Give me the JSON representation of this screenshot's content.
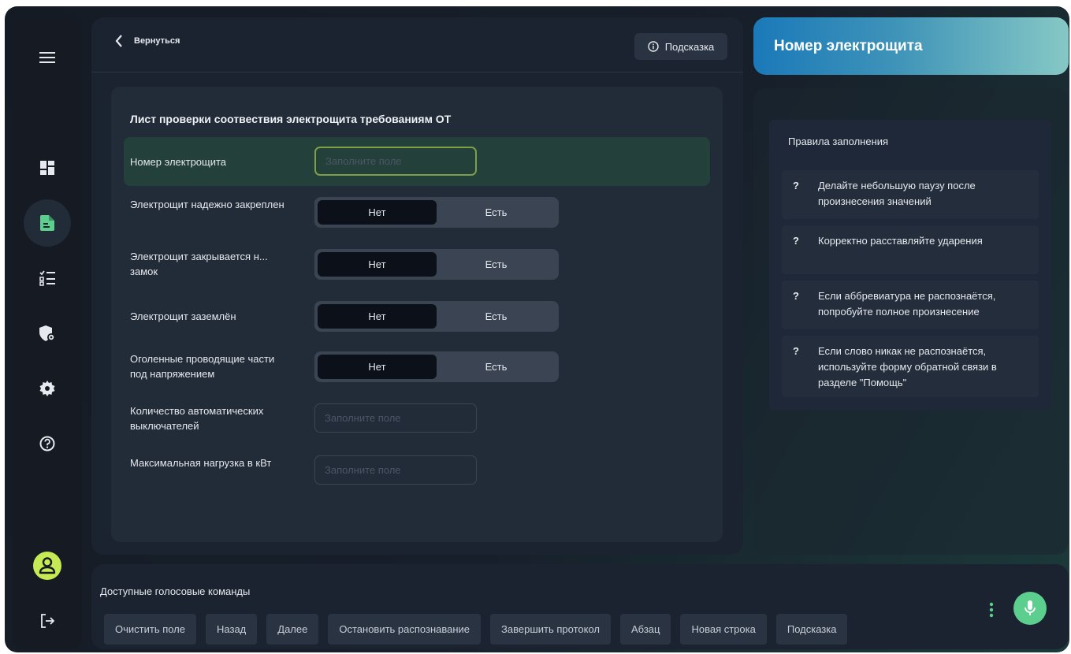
{
  "sidebar": {
    "items": [
      {
        "icon": "menu-icon"
      },
      {
        "icon": "dashboard-icon"
      },
      {
        "icon": "document-icon",
        "active": true
      },
      {
        "icon": "checklist-icon"
      },
      {
        "icon": "shield-icon"
      },
      {
        "icon": "settings-icon"
      },
      {
        "icon": "help-icon"
      },
      {
        "icon": "user-avatar-icon"
      },
      {
        "icon": "logout-icon"
      }
    ],
    "accent_color": "#5ccf8f"
  },
  "topbar": {
    "back_label": "Вернуться",
    "hint_label": "Подсказка"
  },
  "form": {
    "title": "Лист проверки соотвествия электрощита требованиям ОТ",
    "placeholder": "Заполните поле",
    "toggle_no": "Нет",
    "toggle_yes": "Есть",
    "rows": [
      {
        "label": "Номер электрощита",
        "type": "input",
        "active": true
      },
      {
        "label": "Электрощит надежно закреплен",
        "type": "toggle",
        "selected": "Нет"
      },
      {
        "label": "Электрощит закрывается н... замок",
        "type": "toggle",
        "selected": "Нет"
      },
      {
        "label": "Электрощит заземлён",
        "type": "toggle",
        "selected": "Нет"
      },
      {
        "label": "Оголенные проводящие части под напряжением",
        "type": "toggle",
        "selected": "Нет"
      },
      {
        "label": "Количество автоматических выключателей",
        "type": "input"
      },
      {
        "label": "Максимальная нагрузка в кВт",
        "type": "input"
      }
    ]
  },
  "right": {
    "header_title": "Номер электрощита",
    "rules_title": "Правила заполнения",
    "rules": [
      "Делайте небольшую паузу после произнесения значений",
      "Корректно расставляйте ударения",
      "Если аббревиатура не распознаётся, попробуйте полное произнесение",
      "Если слово никак не распознаётся, используйте форму обратной связи в разделе \"Помощь\""
    ],
    "rule_marker": "?"
  },
  "voice": {
    "title": "Доступные голосовые команды",
    "commands": [
      "Очистить поле",
      "Назад",
      "Далее",
      "Остановить распознавание",
      "Завершить протокол",
      "Абзац",
      "Новая строка",
      "Подсказка"
    ]
  }
}
